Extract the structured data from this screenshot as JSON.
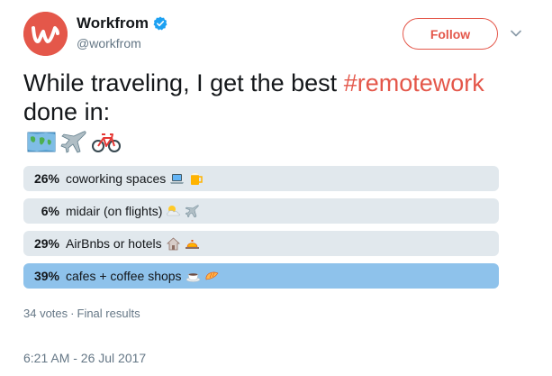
{
  "account": {
    "display_name": "Workfrom",
    "handle": "@workfrom",
    "verified": true,
    "avatar_icon": "workfrom-w-logo",
    "avatar_color": "#e4574a"
  },
  "header": {
    "follow_label": "Follow",
    "menu_icon": "chevron-down-icon",
    "accent": "#e4574a"
  },
  "tweet": {
    "text_before": "While traveling, I get the best ",
    "hashtag": "#remotework",
    "text_after": " done in:",
    "emojis": [
      "world-map",
      "airplane",
      "bicycle"
    ]
  },
  "poll": {
    "choices": [
      {
        "percent_label": "26%",
        "percent": 26,
        "label": "coworking spaces",
        "emojis": [
          "laptop",
          "beer-mug"
        ],
        "winner": false
      },
      {
        "percent_label": "6%",
        "percent": 6,
        "label": "midair (on flights)",
        "emojis": [
          "sun-behind-cloud",
          "airplane"
        ],
        "winner": false
      },
      {
        "percent_label": "29%",
        "percent": 29,
        "label": "AirBnbs or hotels",
        "emojis": [
          "house",
          "bellhop-bell"
        ],
        "winner": false
      },
      {
        "percent_label": "39%",
        "percent": 39,
        "label": "cafes + coffee shops",
        "emojis": [
          "coffee-cup",
          "croissant"
        ],
        "winner": true
      }
    ],
    "votes": "34 votes",
    "status": "Final results",
    "bar_color": "#e1e8ed",
    "winner_color": "#8ec2eb"
  },
  "timestamp": "6:21 AM - 26 Jul 2017"
}
